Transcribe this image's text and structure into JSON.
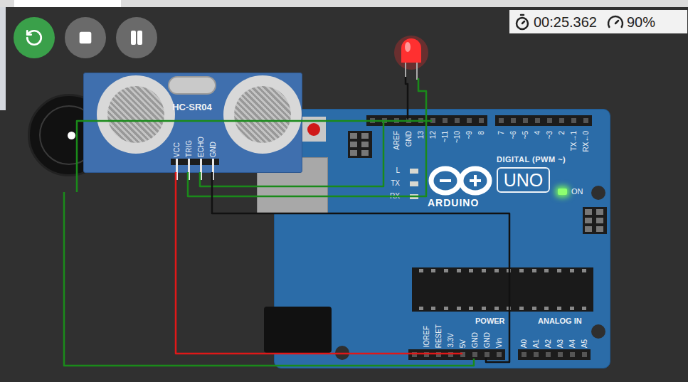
{
  "simulation": {
    "running": true,
    "elapsed": "00:25.362",
    "speed": "90%"
  },
  "sensor": {
    "name": "HC-SR04",
    "pins": [
      "VCC",
      "TRIG",
      "ECHO",
      "GND"
    ]
  },
  "led": {
    "on": true,
    "color": "#ff3030"
  },
  "board": {
    "logo": "ARDUINO",
    "model": "UNO",
    "digital_left": [
      "AREF",
      "GND",
      "13",
      "12",
      "~11",
      "~10",
      "~9",
      "8"
    ],
    "digital_right": [
      "7",
      "~6",
      "~5",
      "4",
      "~3",
      "2",
      "TX→1",
      "RX←0"
    ],
    "digital_label": "DIGITAL (PWM ~)",
    "onboard_leds": [
      {
        "label": "L",
        "on": false
      },
      {
        "label": "TX",
        "on": false
      },
      {
        "label": "RX",
        "on": false
      }
    ],
    "power_led": {
      "label": "ON",
      "on": true
    },
    "power_label": "POWER",
    "power_pins": [
      "IOREF",
      "RESET",
      "3.3V",
      "5V",
      "GND",
      "GND",
      "Vin"
    ],
    "analog_label": "ANALOG IN",
    "analog_pins": [
      "A0",
      "A1",
      "A2",
      "A3",
      "A4",
      "A5"
    ]
  }
}
